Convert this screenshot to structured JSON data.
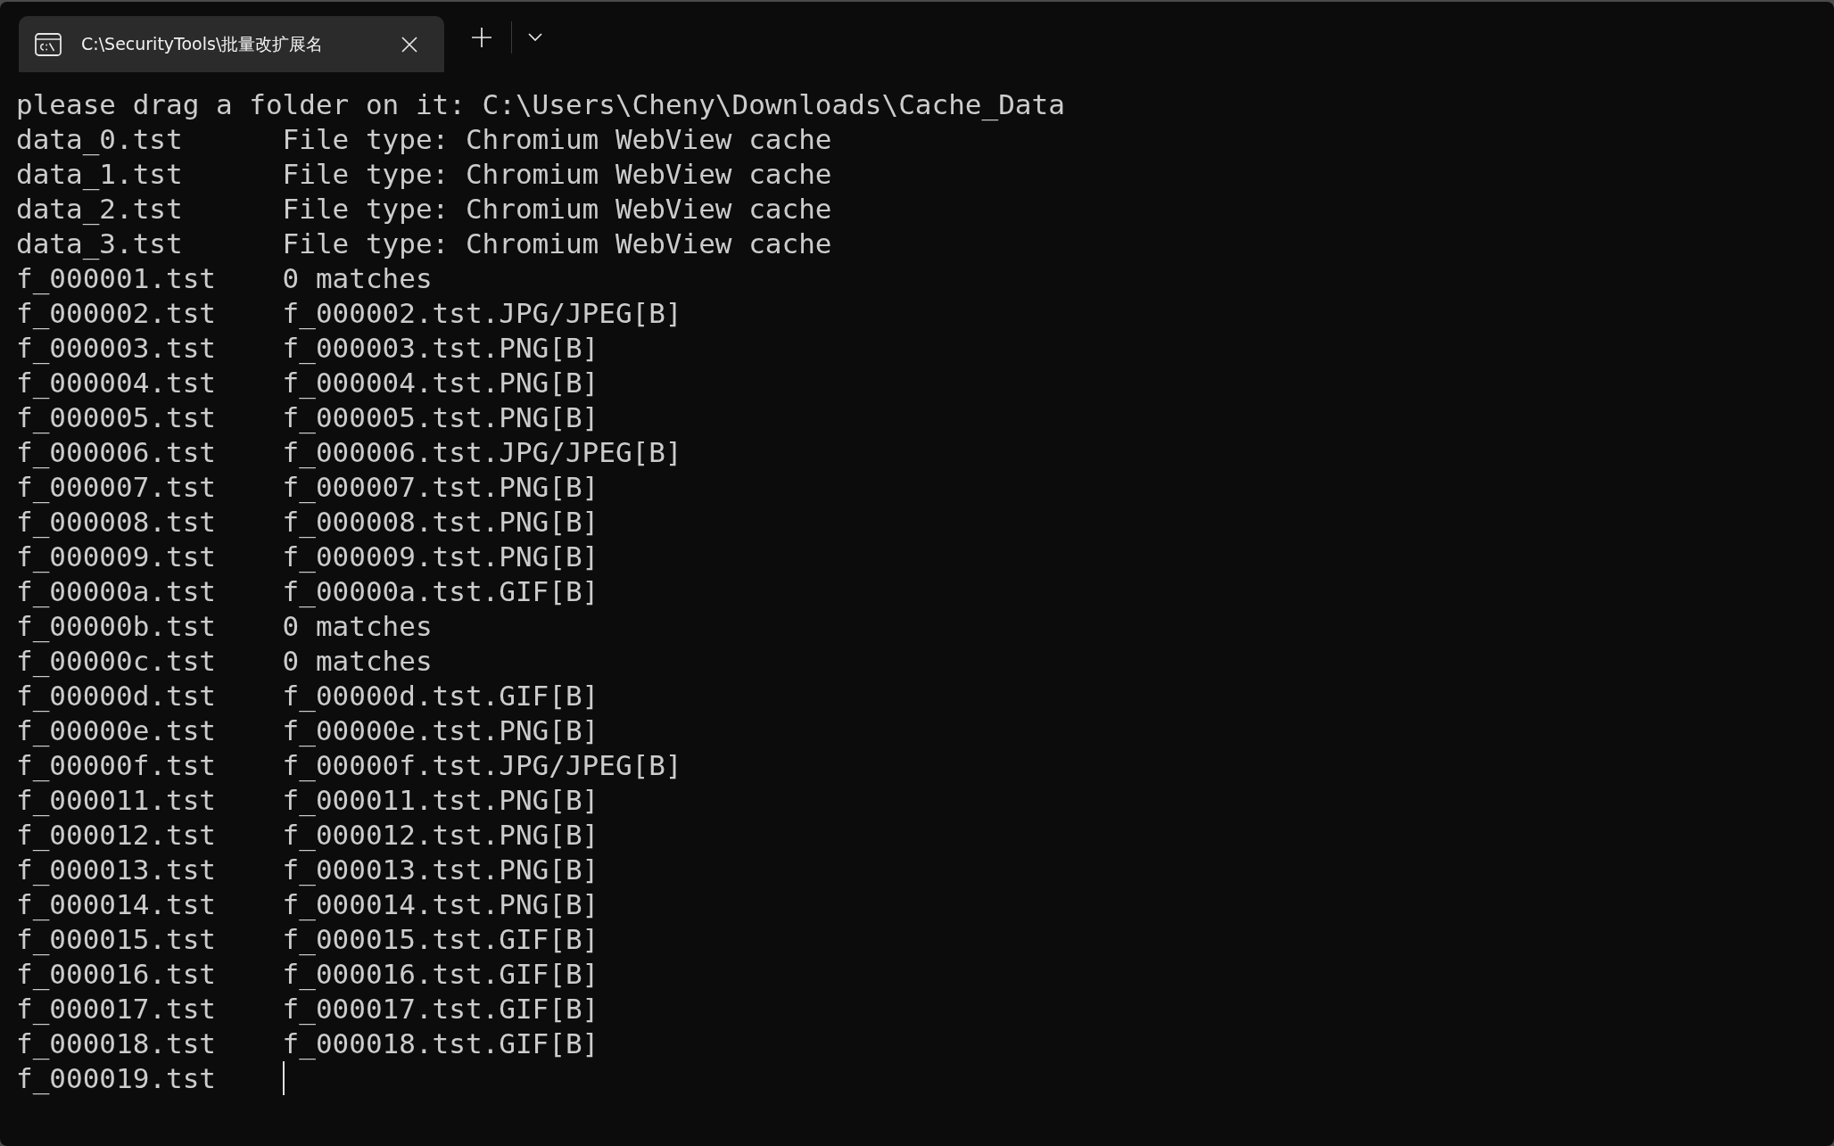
{
  "window": {
    "tabs": [
      {
        "title": "C:\\SecurityTools\\批量改扩展名",
        "selected": true
      }
    ]
  },
  "terminal": {
    "prompt": "please drag a folder on it: C:\\Users\\Cheny\\Downloads\\Cache_Data",
    "lines": [
      {
        "file": "data_0.tst",
        "result": "File type: Chromium WebView cache"
      },
      {
        "file": "data_1.tst",
        "result": "File type: Chromium WebView cache"
      },
      {
        "file": "data_2.tst",
        "result": "File type: Chromium WebView cache"
      },
      {
        "file": "data_3.tst",
        "result": "File type: Chromium WebView cache"
      },
      {
        "file": "f_000001.tst",
        "result": "0 matches"
      },
      {
        "file": "f_000002.tst",
        "result": "f_000002.tst.JPG/JPEG[B]"
      },
      {
        "file": "f_000003.tst",
        "result": "f_000003.tst.PNG[B]"
      },
      {
        "file": "f_000004.tst",
        "result": "f_000004.tst.PNG[B]"
      },
      {
        "file": "f_000005.tst",
        "result": "f_000005.tst.PNG[B]"
      },
      {
        "file": "f_000006.tst",
        "result": "f_000006.tst.JPG/JPEG[B]"
      },
      {
        "file": "f_000007.tst",
        "result": "f_000007.tst.PNG[B]"
      },
      {
        "file": "f_000008.tst",
        "result": "f_000008.tst.PNG[B]"
      },
      {
        "file": "f_000009.tst",
        "result": "f_000009.tst.PNG[B]"
      },
      {
        "file": "f_00000a.tst",
        "result": "f_00000a.tst.GIF[B]"
      },
      {
        "file": "f_00000b.tst",
        "result": "0 matches"
      },
      {
        "file": "f_00000c.tst",
        "result": "0 matches"
      },
      {
        "file": "f_00000d.tst",
        "result": "f_00000d.tst.GIF[B]"
      },
      {
        "file": "f_00000e.tst",
        "result": "f_00000e.tst.PNG[B]"
      },
      {
        "file": "f_00000f.tst",
        "result": "f_00000f.tst.JPG/JPEG[B]"
      },
      {
        "file": "f_000011.tst",
        "result": "f_000011.tst.PNG[B]"
      },
      {
        "file": "f_000012.tst",
        "result": "f_000012.tst.PNG[B]"
      },
      {
        "file": "f_000013.tst",
        "result": "f_000013.tst.PNG[B]"
      },
      {
        "file": "f_000014.tst",
        "result": "f_000014.tst.PNG[B]"
      },
      {
        "file": "f_000015.tst",
        "result": "f_000015.tst.GIF[B]"
      },
      {
        "file": "f_000016.tst",
        "result": "f_000016.tst.GIF[B]"
      },
      {
        "file": "f_000017.tst",
        "result": "f_000017.tst.GIF[B]"
      },
      {
        "file": "f_000018.tst",
        "result": "f_000018.tst.GIF[B]"
      },
      {
        "file": "f_000019.tst"
      }
    ],
    "cursor": true
  }
}
